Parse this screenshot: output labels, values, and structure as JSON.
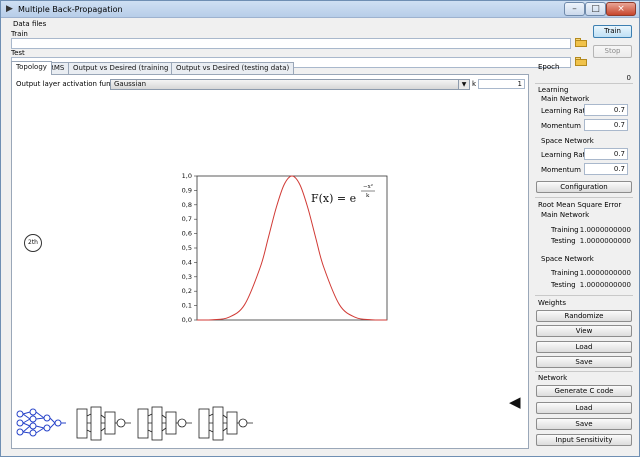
{
  "window": {
    "title": "Multiple Back-Propagation",
    "controls": {
      "minimize": "–",
      "maximize": "□",
      "close": "×"
    }
  },
  "data_files": {
    "section": "Data files",
    "train_label": "Train",
    "train_value": "",
    "test_label": "Test",
    "test_value": "",
    "train_button": "Train",
    "stop_button": "Stop"
  },
  "tabs": [
    {
      "label": "Topology"
    },
    {
      "label": "RMS"
    },
    {
      "label": "Output vs Desired (training data)"
    },
    {
      "label": "Output vs Desired (testing data)"
    }
  ],
  "topology": {
    "activation_label": "Output layer activation function",
    "activation_value": "Gaussian",
    "k_label": "k",
    "k_value": "1",
    "neuron_label": "2th"
  },
  "chart_data": {
    "type": "line",
    "title": "",
    "xlabel": "",
    "ylabel": "",
    "y_ticks": [
      "0,0",
      "0,1",
      "0,2",
      "0,3",
      "0,4",
      "0,5",
      "0,6",
      "0,7",
      "0,8",
      "0,9",
      "1,0"
    ],
    "ylim": [
      0,
      1
    ],
    "xlim": [
      -3,
      3
    ],
    "series": [
      {
        "color": "#d13a35",
        "x": [
          -3,
          -2.5,
          -2,
          -1.5,
          -1,
          -0.75,
          -0.5,
          -0.25,
          0,
          0.25,
          0.5,
          0.75,
          1,
          1.5,
          2,
          2.5,
          3
        ],
        "y": [
          0.0001,
          0.0019,
          0.0183,
          0.1054,
          0.3679,
          0.5698,
          0.7788,
          0.9394,
          1.0,
          0.9394,
          0.7788,
          0.5698,
          0.3679,
          0.1054,
          0.0183,
          0.0019,
          0.0001
        ]
      }
    ],
    "formula": {
      "lhs": "F(x) = e",
      "exp_num": "−x²",
      "exp_den": "k"
    },
    "grid": false
  },
  "right_panel": {
    "epoch_label": "Epoch",
    "epoch_value": "0",
    "learning_label": "Learning",
    "main_network_label": "Main Network",
    "learning_rate_label": "Learning Rate",
    "main_learning_rate": "0.7",
    "momentum_label": "Momentum",
    "main_momentum": "0.7",
    "space_network_label": "Space Network",
    "space_learning_rate": "0.7",
    "space_momentum": "0.7",
    "configuration_button": "Configuration",
    "rms_label": "Root Mean Square Error",
    "rms_main_label": "Main Network",
    "rms_training_label": "Training",
    "rms_main_training": "1.0000000000",
    "rms_testing_label": "Testing",
    "rms_main_testing": "1.0000000000",
    "rms_space_label": "Space Network",
    "rms_space_training": "1.0000000000",
    "rms_space_testing": "1.0000000000",
    "weights_label": "Weights",
    "randomize_button": "Randomize",
    "view_button": "View",
    "load_button": "Load",
    "save_button": "Save",
    "network_label": "Network",
    "generate_c_button": "Generate C code",
    "network_load_button": "Load",
    "network_save_button": "Save",
    "input_sensitivity_button": "Input Sensitivity"
  },
  "colors": {
    "accent": "#3c7fb1",
    "curve": "#d13a35",
    "folder": "#f0c24a"
  }
}
